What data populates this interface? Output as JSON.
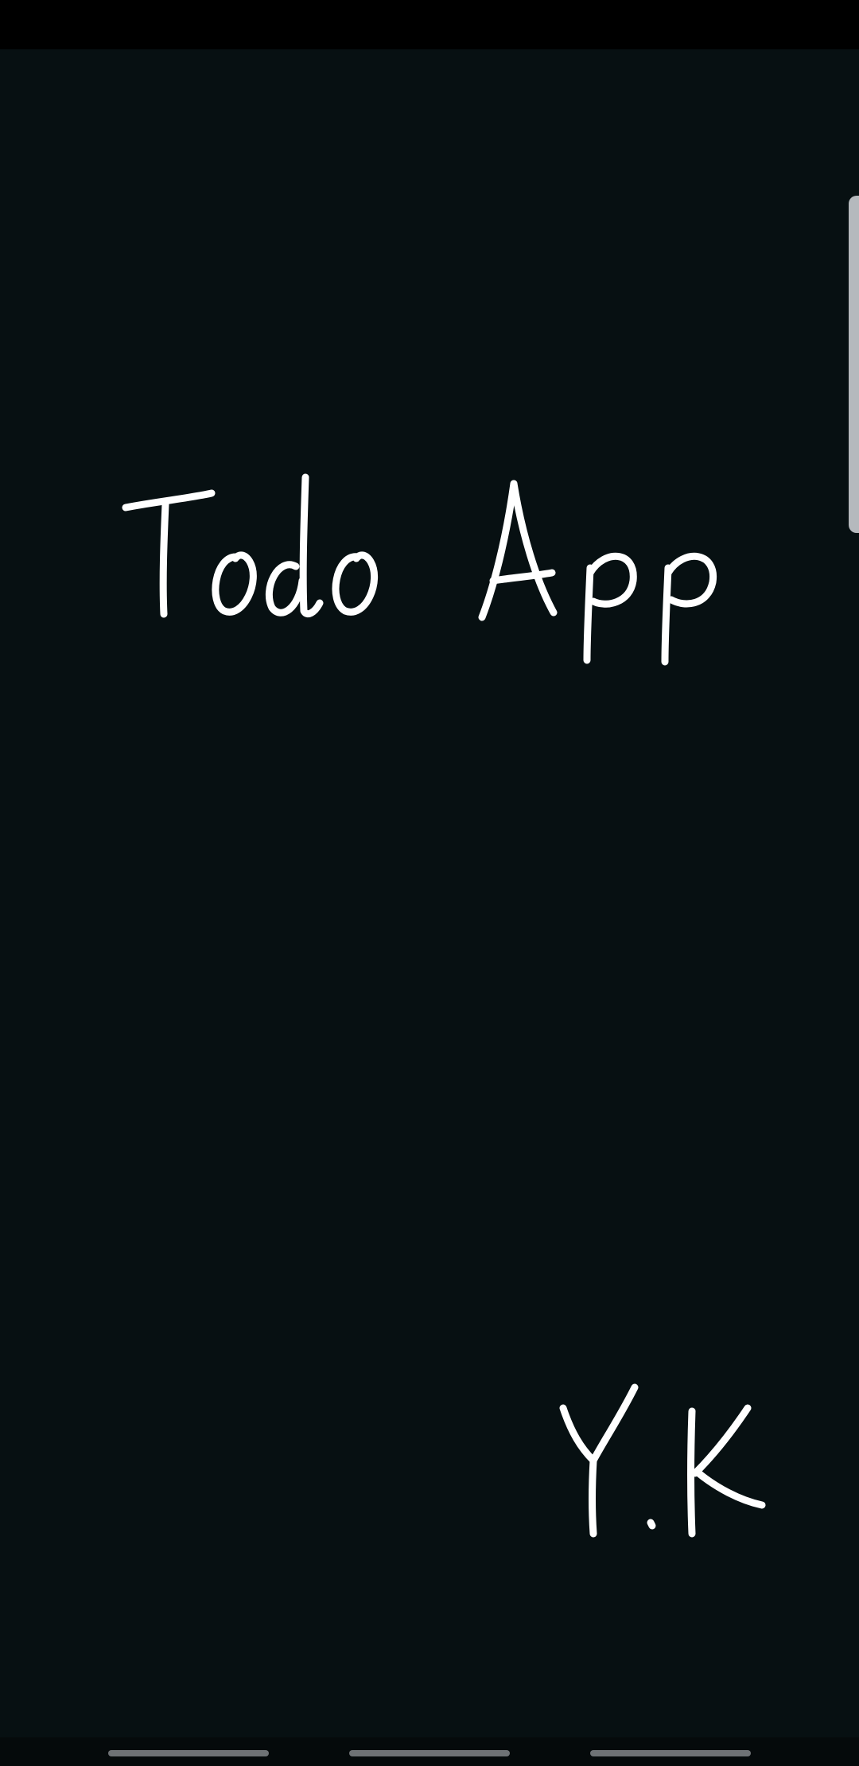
{
  "splash": {
    "title": "Todo App",
    "author_mark": "Y.K"
  },
  "colors": {
    "background": "#071012",
    "status_bar": "#000000",
    "text": "#ffffff",
    "edge_handle": "#b5b9bd",
    "nav_pill": "#6e7275"
  }
}
